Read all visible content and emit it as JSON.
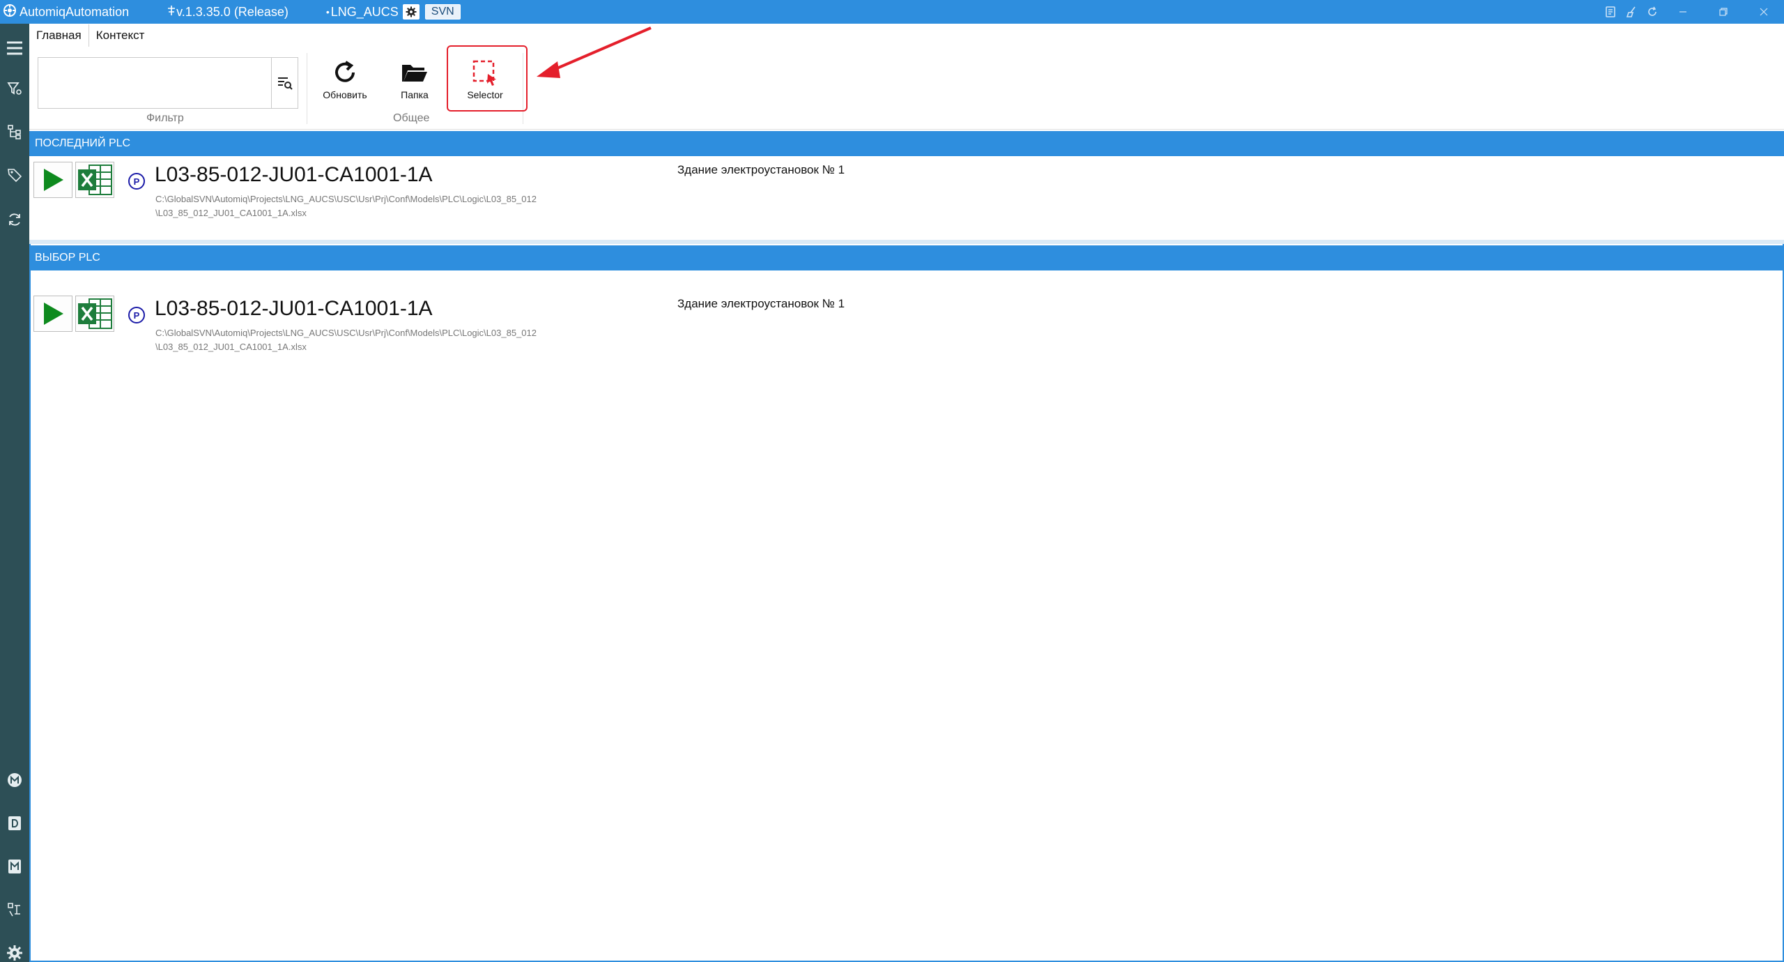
{
  "titlebar": {
    "app_name": "AutomiqAutomation",
    "version": "v.1.3.35.0 (Release)",
    "project": "LNG_AUCS",
    "svn": "SVN"
  },
  "tabs": [
    {
      "label": "Главная"
    },
    {
      "label": "Контекст"
    }
  ],
  "ribbon": {
    "filter": {
      "value": "",
      "placeholder": "",
      "group_label": "Фильтр"
    },
    "general_group_label": "Общее",
    "buttons": {
      "refresh": "Обновить",
      "folder": "Папка",
      "selector": "Selector"
    }
  },
  "sections": {
    "last_plc": {
      "header": "ПОСЛЕДНИЙ PLC",
      "item": {
        "badge": "P",
        "name": "L03-85-012-JU01-CA1001-1A",
        "path_line1": "C:\\GlobalSVN\\Automiq\\Projects\\LNG_AUCS\\USC\\Usr\\Prj\\Conf\\Models\\PLC\\Logic\\L03_85_012",
        "path_line2": "\\L03_85_012_JU01_CA1001_1A.xlsx",
        "description": "Здание электроустановок № 1"
      }
    },
    "select_plc": {
      "header": "ВЫБОР PLC",
      "item": {
        "badge": "P",
        "name": "L03-85-012-JU01-CA1001-1A",
        "path_line1": "C:\\GlobalSVN\\Automiq\\Projects\\LNG_AUCS\\USC\\Usr\\Prj\\Conf\\Models\\PLC\\Logic\\L03_85_012",
        "path_line2": "\\L03_85_012_JU01_CA1001_1A.xlsx",
        "description": "Здание электроустановок № 1"
      }
    }
  },
  "colors": {
    "accent": "#2e8ede",
    "sidebar": "#2d4f56",
    "highlight": "#e41f2b",
    "play_green": "#0e8a1e",
    "excel_green": "#1e7d3c"
  },
  "icons": {
    "sidebar_top": [
      "menu-icon",
      "filter-settings-icon",
      "tree-icon",
      "tags-icon",
      "sync-icon"
    ],
    "sidebar_bottom": [
      "m-circle-icon",
      "d-square-icon",
      "m-square-icon",
      "plc-icon",
      "settings-icon"
    ]
  }
}
